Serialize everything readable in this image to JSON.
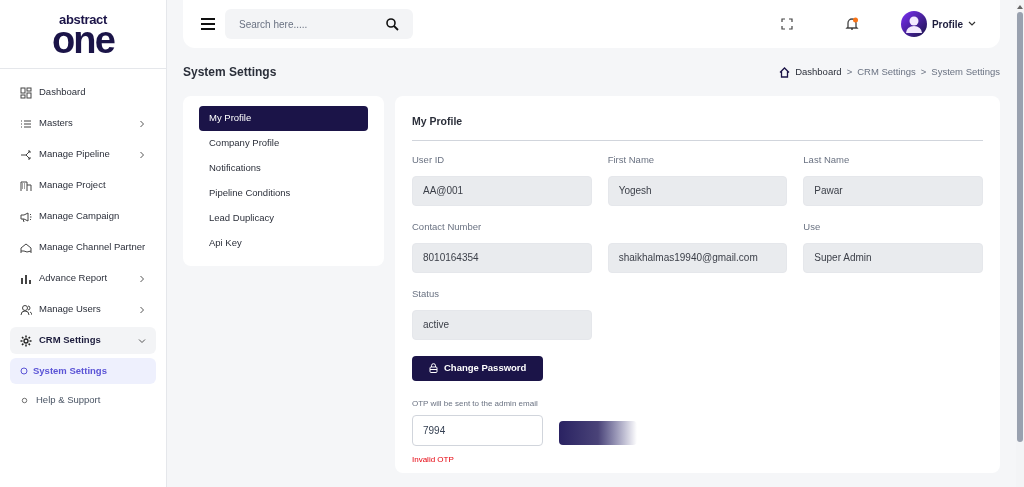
{
  "logo": {
    "top": "abstract",
    "main": "one"
  },
  "sidebar": {
    "items": [
      {
        "label": "Dashboard",
        "has_submenu": false,
        "selected": false
      },
      {
        "label": "Masters",
        "has_submenu": true,
        "selected": false
      },
      {
        "label": "Manage Pipeline",
        "has_submenu": true,
        "selected": false
      },
      {
        "label": "Manage Project",
        "has_submenu": false,
        "selected": false
      },
      {
        "label": "Manage Campaign",
        "has_submenu": false,
        "selected": false
      },
      {
        "label": "Manage Channel Partner",
        "has_submenu": false,
        "selected": false
      },
      {
        "label": "Advance Report",
        "has_submenu": true,
        "selected": false
      },
      {
        "label": "Manage Users",
        "has_submenu": true,
        "selected": false
      },
      {
        "label": "CRM Settings",
        "has_submenu": true,
        "expanded": true,
        "selected": true,
        "children": [
          {
            "label": "System Settings",
            "selected": true
          }
        ]
      },
      {
        "label": "Help & Support",
        "has_submenu": false,
        "selected": false
      }
    ]
  },
  "header": {
    "search": {
      "placeholder": "Search here....."
    },
    "notification_dot": true,
    "profile": "Profile"
  },
  "page_title": "System Settings",
  "breadcrumb": {
    "separator": ">",
    "items": [
      "Dashboard",
      "CRM Settings",
      "System Settings"
    ]
  },
  "settings_menu": [
    {
      "label": "My Profile",
      "selected": true
    },
    {
      "label": "Company Profile",
      "selected": false
    },
    {
      "label": "Notifications",
      "selected": false
    },
    {
      "label": "Pipeline Conditions",
      "selected": false
    },
    {
      "label": "Lead Duplicacy",
      "selected": false
    },
    {
      "label": "Api Key",
      "selected": false
    }
  ],
  "profile": {
    "title": "My Profile",
    "fields": [
      {
        "label": "User ID",
        "value": "AA@001"
      },
      {
        "label": "First Name",
        "value": "Yogesh"
      },
      {
        "label": "Last Name",
        "value": "Pawar"
      },
      {
        "label": "Contact Number",
        "value": "8010164354"
      },
      {
        "value": "shaikhalmas19940@gmail.com"
      },
      {
        "label": "Use",
        "value": "Super Admin"
      },
      {
        "label": "Status",
        "value": "active"
      }
    ],
    "change_password": "Change Password",
    "otp_note": "OTP will be sent to the admin email",
    "otp_value": "7994",
    "error": "Invalid OTP"
  }
}
